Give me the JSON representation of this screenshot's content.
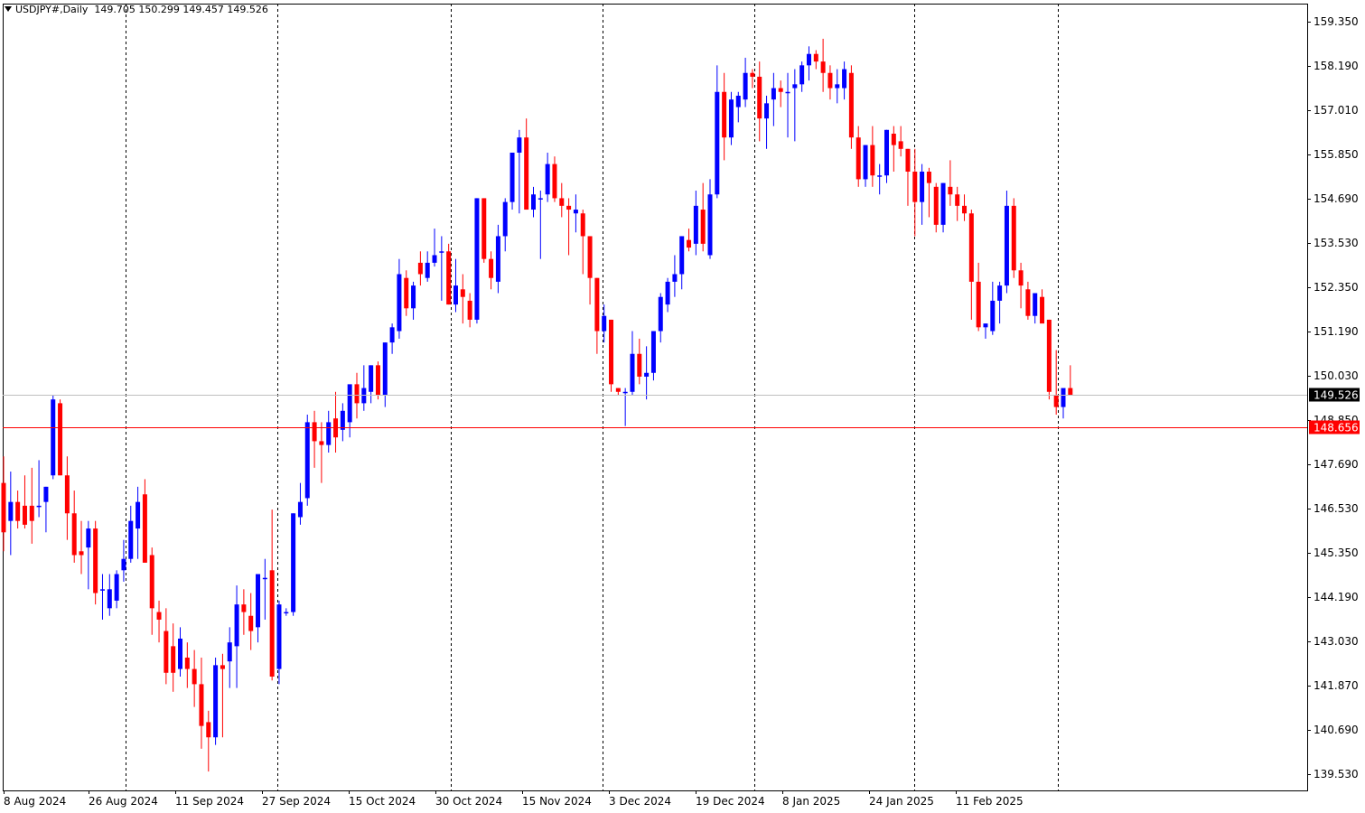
{
  "header": {
    "symbol": "USDJPY#,Daily",
    "ohlc": "149.705 150.299 149.457 149.526"
  },
  "colors": {
    "bull": "#0000ff",
    "bear": "#ff0000",
    "grid": "#000000",
    "bid_line": "#c0c0c0",
    "level_line": "#ff0000",
    "price_badge": "#000000",
    "level_badge": "#ff0000"
  },
  "chart_data": {
    "type": "candlestick",
    "title": "USDJPY#,Daily",
    "ylim": [
      139.1,
      159.7
    ],
    "y_ticks": [
      "159.350",
      "158.190",
      "157.010",
      "155.850",
      "154.690",
      "153.530",
      "152.350",
      "151.190",
      "150.030",
      "148.850",
      "147.690",
      "146.530",
      "145.350",
      "144.190",
      "143.030",
      "141.870",
      "140.690",
      "139.530"
    ],
    "x_labels": [
      "8 Aug 2024",
      "26 Aug 2024",
      "11 Sep 2024",
      "27 Sep 2024",
      "15 Oct 2024",
      "30 Oct 2024",
      "15 Nov 2024",
      "3 Dec 2024",
      "19 Dec 2024",
      "8 Jan 2025",
      "24 Jan 2025",
      "11 Feb 2025"
    ],
    "current_price": "149.526",
    "horizontal_level": "148.656",
    "grid": "vertical dotted",
    "candles": [
      {
        "o": 147.2,
        "h": 147.9,
        "l": 145.4,
        "c": 145.9
      },
      {
        "o": 146.2,
        "h": 147.5,
        "l": 145.3,
        "c": 146.7
      },
      {
        "o": 146.7,
        "h": 147.0,
        "l": 146.0,
        "c": 146.2
      },
      {
        "o": 146.6,
        "h": 147.4,
        "l": 146.0,
        "c": 146.1
      },
      {
        "o": 146.6,
        "h": 147.6,
        "l": 145.6,
        "c": 146.2
      },
      {
        "o": 146.6,
        "h": 147.8,
        "l": 146.3,
        "c": 146.6
      },
      {
        "o": 146.7,
        "h": 147.1,
        "l": 145.9,
        "c": 147.1
      },
      {
        "o": 147.4,
        "h": 149.5,
        "l": 147.3,
        "c": 149.4
      },
      {
        "o": 149.3,
        "h": 149.4,
        "l": 147.4,
        "c": 147.4
      },
      {
        "o": 147.4,
        "h": 147.9,
        "l": 145.7,
        "c": 146.4
      },
      {
        "o": 146.4,
        "h": 147.0,
        "l": 145.1,
        "c": 145.3
      },
      {
        "o": 145.4,
        "h": 146.2,
        "l": 144.8,
        "c": 145.3
      },
      {
        "o": 145.5,
        "h": 146.2,
        "l": 144.4,
        "c": 146.0
      },
      {
        "o": 146.0,
        "h": 146.2,
        "l": 144.0,
        "c": 144.3
      },
      {
        "o": 144.4,
        "h": 144.8,
        "l": 143.6,
        "c": 144.4
      },
      {
        "o": 143.9,
        "h": 144.8,
        "l": 143.7,
        "c": 144.4
      },
      {
        "o": 144.1,
        "h": 144.9,
        "l": 143.9,
        "c": 144.8
      },
      {
        "o": 144.9,
        "h": 145.7,
        "l": 144.6,
        "c": 145.2
      },
      {
        "o": 145.2,
        "h": 146.6,
        "l": 145.1,
        "c": 146.2
      },
      {
        "o": 146.0,
        "h": 147.1,
        "l": 145.2,
        "c": 146.7
      },
      {
        "o": 146.9,
        "h": 147.3,
        "l": 145.1,
        "c": 145.1
      },
      {
        "o": 145.3,
        "h": 145.5,
        "l": 143.2,
        "c": 143.9
      },
      {
        "o": 143.8,
        "h": 144.1,
        "l": 143.0,
        "c": 143.6
      },
      {
        "o": 143.3,
        "h": 143.9,
        "l": 141.9,
        "c": 142.2
      },
      {
        "o": 142.9,
        "h": 143.5,
        "l": 141.7,
        "c": 142.2
      },
      {
        "o": 142.3,
        "h": 143.4,
        "l": 142.1,
        "c": 143.1
      },
      {
        "o": 142.6,
        "h": 143.0,
        "l": 141.8,
        "c": 142.3
      },
      {
        "o": 142.3,
        "h": 142.8,
        "l": 141.3,
        "c": 141.9
      },
      {
        "o": 141.9,
        "h": 142.6,
        "l": 140.2,
        "c": 140.8
      },
      {
        "o": 140.9,
        "h": 141.2,
        "l": 139.6,
        "c": 140.5
      },
      {
        "o": 140.5,
        "h": 142.6,
        "l": 140.3,
        "c": 142.4
      },
      {
        "o": 142.4,
        "h": 142.7,
        "l": 140.5,
        "c": 142.3
      },
      {
        "o": 142.5,
        "h": 143.4,
        "l": 141.8,
        "c": 143.0
      },
      {
        "o": 142.9,
        "h": 144.5,
        "l": 141.8,
        "c": 144.0
      },
      {
        "o": 144.0,
        "h": 144.4,
        "l": 143.2,
        "c": 143.8
      },
      {
        "o": 143.7,
        "h": 144.3,
        "l": 142.8,
        "c": 143.3
      },
      {
        "o": 143.4,
        "h": 144.7,
        "l": 143.0,
        "c": 144.8
      },
      {
        "o": 144.7,
        "h": 145.2,
        "l": 143.6,
        "c": 144.7
      },
      {
        "o": 144.9,
        "h": 146.5,
        "l": 142.0,
        "c": 142.1
      },
      {
        "o": 142.3,
        "h": 144.1,
        "l": 141.9,
        "c": 144.0
      },
      {
        "o": 143.8,
        "h": 143.9,
        "l": 143.7,
        "c": 143.8
      },
      {
        "o": 143.8,
        "h": 146.4,
        "l": 143.7,
        "c": 146.4
      },
      {
        "o": 146.3,
        "h": 147.2,
        "l": 146.1,
        "c": 146.7
      },
      {
        "o": 146.8,
        "h": 149.0,
        "l": 146.6,
        "c": 148.8
      },
      {
        "o": 148.8,
        "h": 149.1,
        "l": 147.6,
        "c": 148.3
      },
      {
        "o": 148.3,
        "h": 148.8,
        "l": 147.2,
        "c": 148.2
      },
      {
        "o": 148.2,
        "h": 149.1,
        "l": 148.0,
        "c": 148.8
      },
      {
        "o": 148.9,
        "h": 149.6,
        "l": 148.0,
        "c": 148.4
      },
      {
        "o": 148.6,
        "h": 149.3,
        "l": 148.3,
        "c": 149.1
      },
      {
        "o": 148.8,
        "h": 149.7,
        "l": 148.4,
        "c": 149.8
      },
      {
        "o": 149.8,
        "h": 150.1,
        "l": 148.9,
        "c": 149.3
      },
      {
        "o": 149.3,
        "h": 150.3,
        "l": 149.1,
        "c": 149.7
      },
      {
        "o": 149.6,
        "h": 150.3,
        "l": 149.3,
        "c": 150.3
      },
      {
        "o": 150.3,
        "h": 150.4,
        "l": 149.4,
        "c": 149.5
      },
      {
        "o": 149.5,
        "h": 150.9,
        "l": 149.2,
        "c": 150.9
      },
      {
        "o": 150.9,
        "h": 151.4,
        "l": 150.6,
        "c": 151.3
      },
      {
        "o": 151.2,
        "h": 153.1,
        "l": 151.0,
        "c": 152.7
      },
      {
        "o": 152.6,
        "h": 152.8,
        "l": 151.6,
        "c": 151.8
      },
      {
        "o": 151.8,
        "h": 152.5,
        "l": 151.5,
        "c": 152.4
      },
      {
        "o": 153.0,
        "h": 153.3,
        "l": 152.4,
        "c": 152.7
      },
      {
        "o": 152.6,
        "h": 153.3,
        "l": 152.5,
        "c": 153.0
      },
      {
        "o": 153.0,
        "h": 153.9,
        "l": 152.9,
        "c": 153.2
      },
      {
        "o": 153.3,
        "h": 153.7,
        "l": 152.0,
        "c": 153.3
      },
      {
        "o": 153.3,
        "h": 153.5,
        "l": 151.9,
        "c": 151.9
      },
      {
        "o": 151.9,
        "h": 153.1,
        "l": 151.7,
        "c": 152.4
      },
      {
        "o": 152.3,
        "h": 152.7,
        "l": 151.4,
        "c": 152.1
      },
      {
        "o": 152.0,
        "h": 152.2,
        "l": 151.3,
        "c": 151.5
      },
      {
        "o": 151.5,
        "h": 154.7,
        "l": 151.4,
        "c": 154.7
      },
      {
        "o": 154.7,
        "h": 154.7,
        "l": 153.0,
        "c": 153.1
      },
      {
        "o": 153.1,
        "h": 153.3,
        "l": 152.3,
        "c": 152.6
      },
      {
        "o": 152.5,
        "h": 154.0,
        "l": 152.2,
        "c": 153.7
      },
      {
        "o": 153.7,
        "h": 154.7,
        "l": 153.3,
        "c": 154.6
      },
      {
        "o": 154.6,
        "h": 155.7,
        "l": 154.4,
        "c": 155.9
      },
      {
        "o": 155.9,
        "h": 156.5,
        "l": 154.3,
        "c": 156.3
      },
      {
        "o": 156.3,
        "h": 156.8,
        "l": 154.4,
        "c": 154.4
      },
      {
        "o": 154.4,
        "h": 155.0,
        "l": 154.2,
        "c": 154.8
      },
      {
        "o": 154.7,
        "h": 154.9,
        "l": 153.1,
        "c": 154.7
      },
      {
        "o": 154.8,
        "h": 155.9,
        "l": 154.6,
        "c": 155.6
      },
      {
        "o": 155.6,
        "h": 155.8,
        "l": 154.6,
        "c": 154.7
      },
      {
        "o": 154.7,
        "h": 155.1,
        "l": 154.2,
        "c": 154.5
      },
      {
        "o": 154.5,
        "h": 154.7,
        "l": 153.2,
        "c": 154.4
      },
      {
        "o": 154.3,
        "h": 154.8,
        "l": 153.8,
        "c": 154.4
      },
      {
        "o": 154.3,
        "h": 154.4,
        "l": 152.7,
        "c": 153.7
      },
      {
        "o": 153.7,
        "h": 153.7,
        "l": 151.9,
        "c": 152.6
      },
      {
        "o": 152.6,
        "h": 152.6,
        "l": 150.6,
        "c": 151.2
      },
      {
        "o": 151.2,
        "h": 151.9,
        "l": 150.9,
        "c": 151.6
      },
      {
        "o": 151.5,
        "h": 151.5,
        "l": 149.6,
        "c": 149.8
      },
      {
        "o": 149.7,
        "h": 149.7,
        "l": 149.5,
        "c": 149.6
      },
      {
        "o": 149.6,
        "h": 149.7,
        "l": 148.7,
        "c": 149.6
      },
      {
        "o": 149.6,
        "h": 151.2,
        "l": 149.5,
        "c": 150.6
      },
      {
        "o": 150.6,
        "h": 151.0,
        "l": 149.8,
        "c": 150.0
      },
      {
        "o": 150.0,
        "h": 150.8,
        "l": 149.4,
        "c": 150.1
      },
      {
        "o": 150.1,
        "h": 151.2,
        "l": 149.9,
        "c": 151.2
      },
      {
        "o": 151.2,
        "h": 152.2,
        "l": 150.9,
        "c": 152.1
      },
      {
        "o": 151.9,
        "h": 152.6,
        "l": 151.7,
        "c": 152.5
      },
      {
        "o": 152.5,
        "h": 153.2,
        "l": 152.1,
        "c": 152.7
      },
      {
        "o": 152.7,
        "h": 153.7,
        "l": 152.3,
        "c": 153.7
      },
      {
        "o": 153.6,
        "h": 153.9,
        "l": 153.3,
        "c": 153.4
      },
      {
        "o": 153.5,
        "h": 154.9,
        "l": 153.2,
        "c": 154.5
      },
      {
        "o": 154.4,
        "h": 155.1,
        "l": 153.3,
        "c": 153.5
      },
      {
        "o": 153.2,
        "h": 155.2,
        "l": 153.1,
        "c": 154.8
      },
      {
        "o": 154.8,
        "h": 158.2,
        "l": 154.7,
        "c": 157.5
      },
      {
        "o": 157.5,
        "h": 158.0,
        "l": 155.7,
        "c": 156.3
      },
      {
        "o": 156.3,
        "h": 157.5,
        "l": 156.1,
        "c": 157.3
      },
      {
        "o": 157.1,
        "h": 157.5,
        "l": 156.7,
        "c": 157.4
      },
      {
        "o": 157.3,
        "h": 158.4,
        "l": 157.1,
        "c": 158.0
      },
      {
        "o": 158.0,
        "h": 158.1,
        "l": 157.6,
        "c": 157.9
      },
      {
        "o": 157.9,
        "h": 158.3,
        "l": 156.2,
        "c": 156.8
      },
      {
        "o": 156.8,
        "h": 157.4,
        "l": 156.0,
        "c": 157.2
      },
      {
        "o": 157.3,
        "h": 158.0,
        "l": 156.6,
        "c": 157.6
      },
      {
        "o": 157.6,
        "h": 157.8,
        "l": 157.1,
        "c": 157.5
      },
      {
        "o": 157.5,
        "h": 158.0,
        "l": 156.3,
        "c": 157.5
      },
      {
        "o": 157.6,
        "h": 158.1,
        "l": 156.2,
        "c": 157.7
      },
      {
        "o": 157.7,
        "h": 158.3,
        "l": 157.5,
        "c": 158.2
      },
      {
        "o": 158.2,
        "h": 158.7,
        "l": 157.8,
        "c": 158.5
      },
      {
        "o": 158.5,
        "h": 158.6,
        "l": 158.1,
        "c": 158.3
      },
      {
        "o": 158.3,
        "h": 158.9,
        "l": 157.5,
        "c": 158.0
      },
      {
        "o": 158.0,
        "h": 158.2,
        "l": 157.3,
        "c": 157.6
      },
      {
        "o": 157.6,
        "h": 158.1,
        "l": 157.2,
        "c": 157.7
      },
      {
        "o": 157.6,
        "h": 158.3,
        "l": 157.3,
        "c": 158.1
      },
      {
        "o": 158.0,
        "h": 158.2,
        "l": 156.0,
        "c": 156.3
      },
      {
        "o": 156.3,
        "h": 156.6,
        "l": 155.0,
        "c": 155.2
      },
      {
        "o": 155.2,
        "h": 156.1,
        "l": 155.0,
        "c": 156.1
      },
      {
        "o": 156.1,
        "h": 156.6,
        "l": 155.0,
        "c": 155.3
      },
      {
        "o": 155.3,
        "h": 155.6,
        "l": 154.8,
        "c": 155.3
      },
      {
        "o": 155.3,
        "h": 156.5,
        "l": 155.1,
        "c": 156.5
      },
      {
        "o": 156.4,
        "h": 156.6,
        "l": 155.4,
        "c": 156.1
      },
      {
        "o": 156.2,
        "h": 156.6,
        "l": 155.8,
        "c": 156.0
      },
      {
        "o": 156.0,
        "h": 156.0,
        "l": 154.5,
        "c": 155.4
      },
      {
        "o": 155.4,
        "h": 156.0,
        "l": 153.7,
        "c": 154.6
      },
      {
        "o": 154.6,
        "h": 155.6,
        "l": 154.0,
        "c": 155.4
      },
      {
        "o": 155.4,
        "h": 155.5,
        "l": 154.2,
        "c": 155.1
      },
      {
        "o": 155.0,
        "h": 155.1,
        "l": 153.8,
        "c": 154.0
      },
      {
        "o": 154.0,
        "h": 155.1,
        "l": 153.8,
        "c": 155.1
      },
      {
        "o": 155.0,
        "h": 155.7,
        "l": 154.5,
        "c": 154.8
      },
      {
        "o": 154.8,
        "h": 155.0,
        "l": 154.1,
        "c": 154.5
      },
      {
        "o": 154.5,
        "h": 154.8,
        "l": 154.1,
        "c": 154.3
      },
      {
        "o": 154.3,
        "h": 154.4,
        "l": 151.5,
        "c": 152.5
      },
      {
        "o": 152.5,
        "h": 153.0,
        "l": 151.2,
        "c": 151.3
      },
      {
        "o": 151.3,
        "h": 151.4,
        "l": 151.0,
        "c": 151.4
      },
      {
        "o": 151.2,
        "h": 152.5,
        "l": 151.1,
        "c": 152.0
      },
      {
        "o": 152.0,
        "h": 152.5,
        "l": 151.4,
        "c": 152.4
      },
      {
        "o": 152.4,
        "h": 154.9,
        "l": 152.2,
        "c": 154.5
      },
      {
        "o": 154.5,
        "h": 154.7,
        "l": 152.6,
        "c": 152.8
      },
      {
        "o": 152.8,
        "h": 153.0,
        "l": 151.8,
        "c": 152.4
      },
      {
        "o": 152.3,
        "h": 152.5,
        "l": 151.5,
        "c": 151.6
      },
      {
        "o": 151.6,
        "h": 152.2,
        "l": 151.4,
        "c": 152.2
      },
      {
        "o": 152.1,
        "h": 152.3,
        "l": 151.5,
        "c": 151.4
      },
      {
        "o": 151.5,
        "h": 151.5,
        "l": 149.4,
        "c": 149.6
      },
      {
        "o": 149.5,
        "h": 150.7,
        "l": 149.0,
        "c": 149.2
      },
      {
        "o": 149.2,
        "h": 149.6,
        "l": 148.9,
        "c": 149.7
      },
      {
        "o": 149.7,
        "h": 150.3,
        "l": 149.5,
        "c": 149.5
      }
    ]
  }
}
